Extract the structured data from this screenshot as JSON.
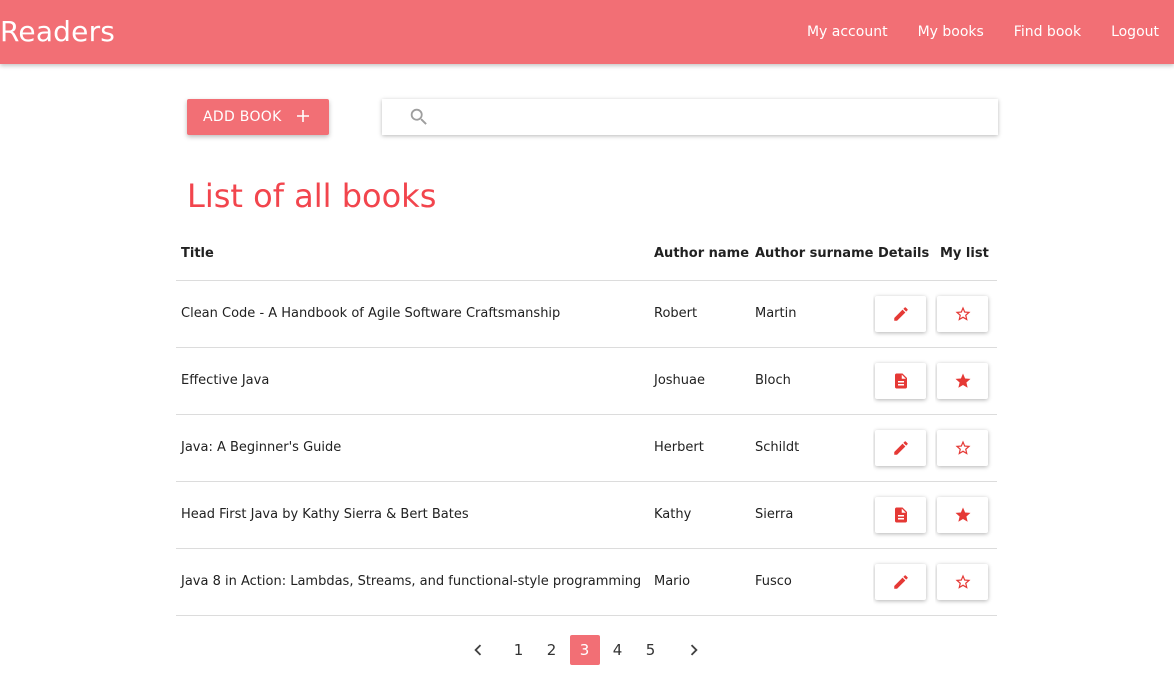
{
  "navbar": {
    "brand": "Readers",
    "links": [
      "My account",
      "My books",
      "Find book",
      "Logout"
    ]
  },
  "toolbar": {
    "add_book_label": "ADD BOOK",
    "add_icon": "plus-icon",
    "search_icon": "search-icon",
    "search_value": ""
  },
  "page_title": "List of all books",
  "table": {
    "headers": [
      "Title",
      "Author name",
      "Author surname",
      "Details",
      "My list"
    ],
    "rows": [
      {
        "title": "Clean Code - A Handbook of Agile Software Craftsmanship",
        "author_name": "Robert",
        "author_surname": "Martin",
        "details_icon": "edit-icon",
        "mylist_icon": "star-outline-icon"
      },
      {
        "title": "Effective Java",
        "author_name": "Joshuae",
        "author_surname": "Bloch",
        "details_icon": "document-icon",
        "mylist_icon": "star-filled-icon"
      },
      {
        "title": "Java: A Beginner's Guide",
        "author_name": "Herbert",
        "author_surname": "Schildt",
        "details_icon": "edit-icon",
        "mylist_icon": "star-outline-icon"
      },
      {
        "title": "Head First Java by Kathy Sierra & Bert Bates",
        "author_name": "Kathy",
        "author_surname": "Sierra",
        "details_icon": "document-icon",
        "mylist_icon": "star-filled-icon"
      },
      {
        "title": "Java 8 in Action: Lambdas, Streams, and functional-style programming",
        "author_name": "Mario",
        "author_surname": "Fusco",
        "details_icon": "edit-icon",
        "mylist_icon": "star-outline-icon"
      }
    ]
  },
  "pagination": {
    "pages": [
      "1",
      "2",
      "3",
      "4",
      "5"
    ],
    "current": "3"
  },
  "colors": {
    "primary": "#f26f75",
    "accent_text": "#f2454d",
    "icon_red": "#e53935"
  }
}
